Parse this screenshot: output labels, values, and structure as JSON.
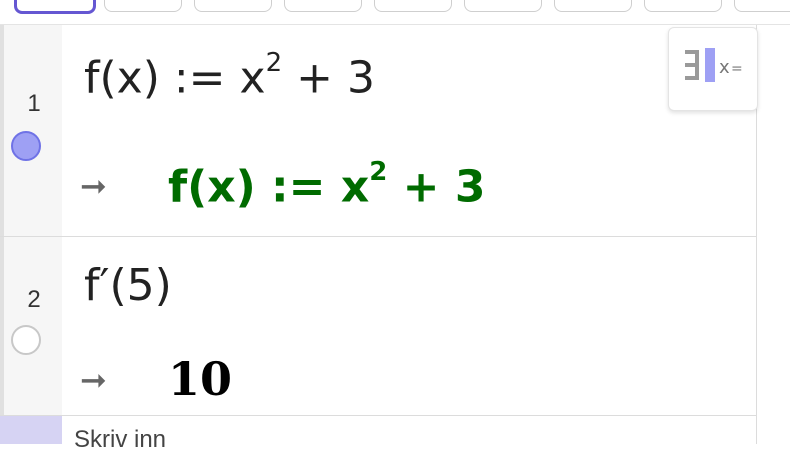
{
  "rows": [
    {
      "number": "1",
      "input": {
        "lhs": "f(x) := x",
        "exp": "2",
        "rhs": " + 3"
      },
      "output_arrow": "➞",
      "output": {
        "lhs": "f(x)  :=  x",
        "exp": "2",
        "rhs": " + 3"
      },
      "visible": true
    },
    {
      "number": "2",
      "input": {
        "text": "f′(5)"
      },
      "output_arrow": "➞",
      "output": {
        "text": "10"
      },
      "visible": false
    }
  ],
  "input_placeholder": "Skriv inn",
  "icons": {
    "toggle_on": "visibility-on-icon",
    "toggle_off": "visibility-off-icon",
    "menu": "output-format-menu-icon"
  },
  "colors": {
    "accent": "#6557d2",
    "output_green": "#006b00",
    "toggle_fill": "#9ea0f4"
  }
}
